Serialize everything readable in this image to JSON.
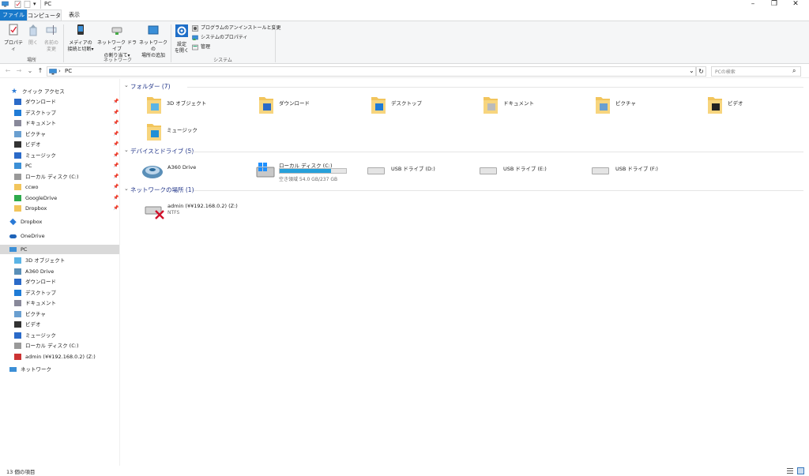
{
  "window": {
    "title": "PC",
    "minimize": "–",
    "maximize": "❐",
    "close": "✕"
  },
  "tabs": {
    "file": "ファイル",
    "computer": "コンピューター",
    "view": "表示"
  },
  "ribbon": {
    "location": {
      "properties": "プロパティ",
      "open": "開く",
      "rename_l1": "名前の",
      "rename_l2": "変更",
      "label": "場所"
    },
    "network": {
      "media_l1": "メディアの",
      "media_l2": "接続と切断▾",
      "map_l1": "ネットワーク ドライブ",
      "map_l2": "の割り当て▾",
      "add_l1": "ネットワークの",
      "add_l2": "場所の追加",
      "label": "ネットワーク"
    },
    "system": {
      "settings_l1": "設定",
      "settings_l2": "を開く",
      "uninstall": "プログラムのアンインストールと変更",
      "sysprops": "システムのプロパティ",
      "manage": "管理",
      "label": "システム"
    }
  },
  "address": {
    "path": "PC",
    "chevron": "›",
    "search_placeholder": "PCの検索",
    "back": "←",
    "forward": "→",
    "recent": "⌄",
    "up": "↑",
    "dropdown": "⌄",
    "refresh": "↻",
    "search_icon": "⌕"
  },
  "sidebar": {
    "quick_access": "クイック アクセス",
    "qa_items": [
      "ダウンロード",
      "デスクトップ",
      "ドキュメント",
      "ピクチャ",
      "ビデオ",
      "ミュージック",
      "PC",
      "ローカル ディスク (C:)",
      "ccwo",
      "GoogleDrive",
      "Dropbox"
    ],
    "dropbox": "Dropbox",
    "onedrive": "OneDrive",
    "pc": "PC",
    "pc_items": [
      "3D オブジェクト",
      "A360 Drive",
      "ダウンロード",
      "デスクトップ",
      "ドキュメント",
      "ピクチャ",
      "ビデオ",
      "ミュージック",
      "ローカル ディスク (C:)",
      "admin (¥¥192.168.0.2) (Z:)"
    ],
    "network": "ネットワーク",
    "pin": "📌"
  },
  "groups": {
    "folders": {
      "title": "フォルダー (7)",
      "items": [
        "3D オブジェクト",
        "ダウンロード",
        "デスクトップ",
        "ドキュメント",
        "ピクチャ",
        "ビデオ",
        "ミュージック"
      ]
    },
    "devices": {
      "title": "デバイスとドライブ (5)",
      "a360": "A360 Drive",
      "local_c": "ローカル ディスク (C:)",
      "local_c_free": "空き領域 54.0 GB/237 GB",
      "local_c_used_fraction": 0.77,
      "usb": [
        "USB ドライブ (D:)",
        "USB ドライブ (E:)",
        "USB ドライブ (F:)"
      ]
    },
    "network": {
      "title": "ネットワークの場所 (1)",
      "admin": "admin (¥¥192.168.0.2) (Z:)",
      "fs": "NTFS"
    }
  },
  "status": {
    "count": "13 個の項目"
  },
  "colors": {
    "accent": "#1979ca",
    "folder": "#f2c55c",
    "bar": "#26a0da"
  }
}
